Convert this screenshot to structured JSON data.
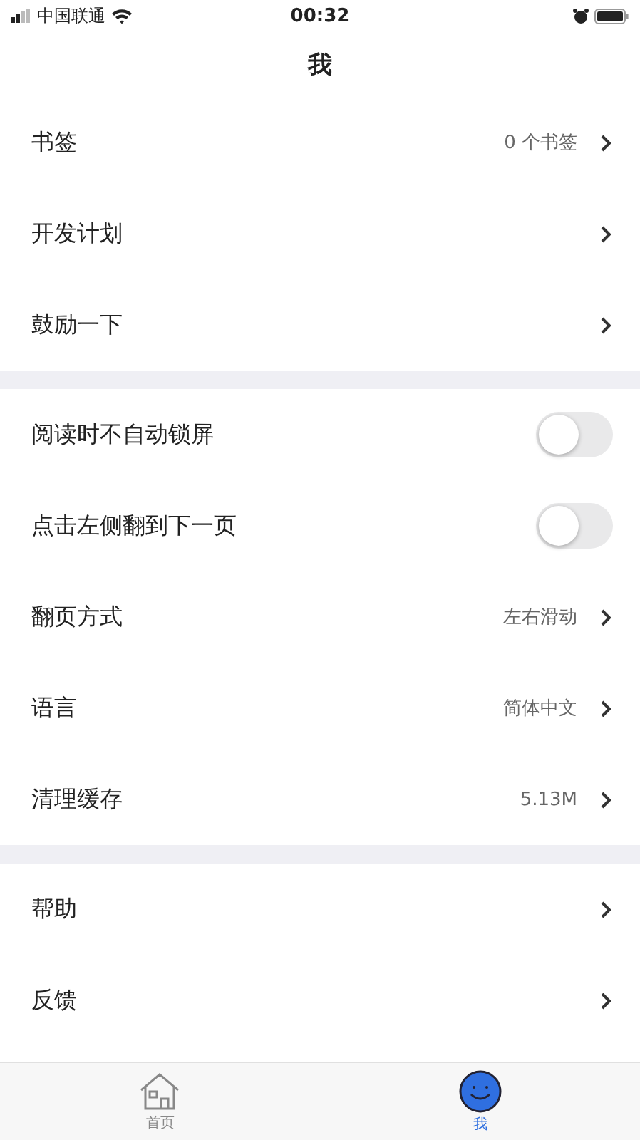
{
  "status_bar": {
    "carrier": "中国联通",
    "time": "00:32"
  },
  "title": "我",
  "sections": [
    {
      "rows": [
        {
          "kind": "link",
          "label": "书签",
          "value": "0 个书签"
        },
        {
          "kind": "link",
          "label": "开发计划"
        },
        {
          "kind": "link",
          "label": "鼓励一下"
        }
      ]
    },
    {
      "rows": [
        {
          "kind": "toggle",
          "label": "阅读时不自动锁屏",
          "on": false
        },
        {
          "kind": "toggle",
          "label": "点击左侧翻到下一页",
          "on": false
        },
        {
          "kind": "link",
          "label": "翻页方式",
          "value": "左右滑动"
        },
        {
          "kind": "link",
          "label": "语言",
          "value": "简体中文"
        },
        {
          "kind": "link",
          "label": "清理缓存",
          "value": "5.13M"
        }
      ]
    },
    {
      "rows": [
        {
          "kind": "link",
          "label": "帮助"
        },
        {
          "kind": "link",
          "label": "反馈"
        }
      ]
    }
  ],
  "tabs": [
    {
      "kind": "home",
      "label": "首页",
      "selected": false
    },
    {
      "kind": "me",
      "label": "我",
      "selected": true
    }
  ]
}
